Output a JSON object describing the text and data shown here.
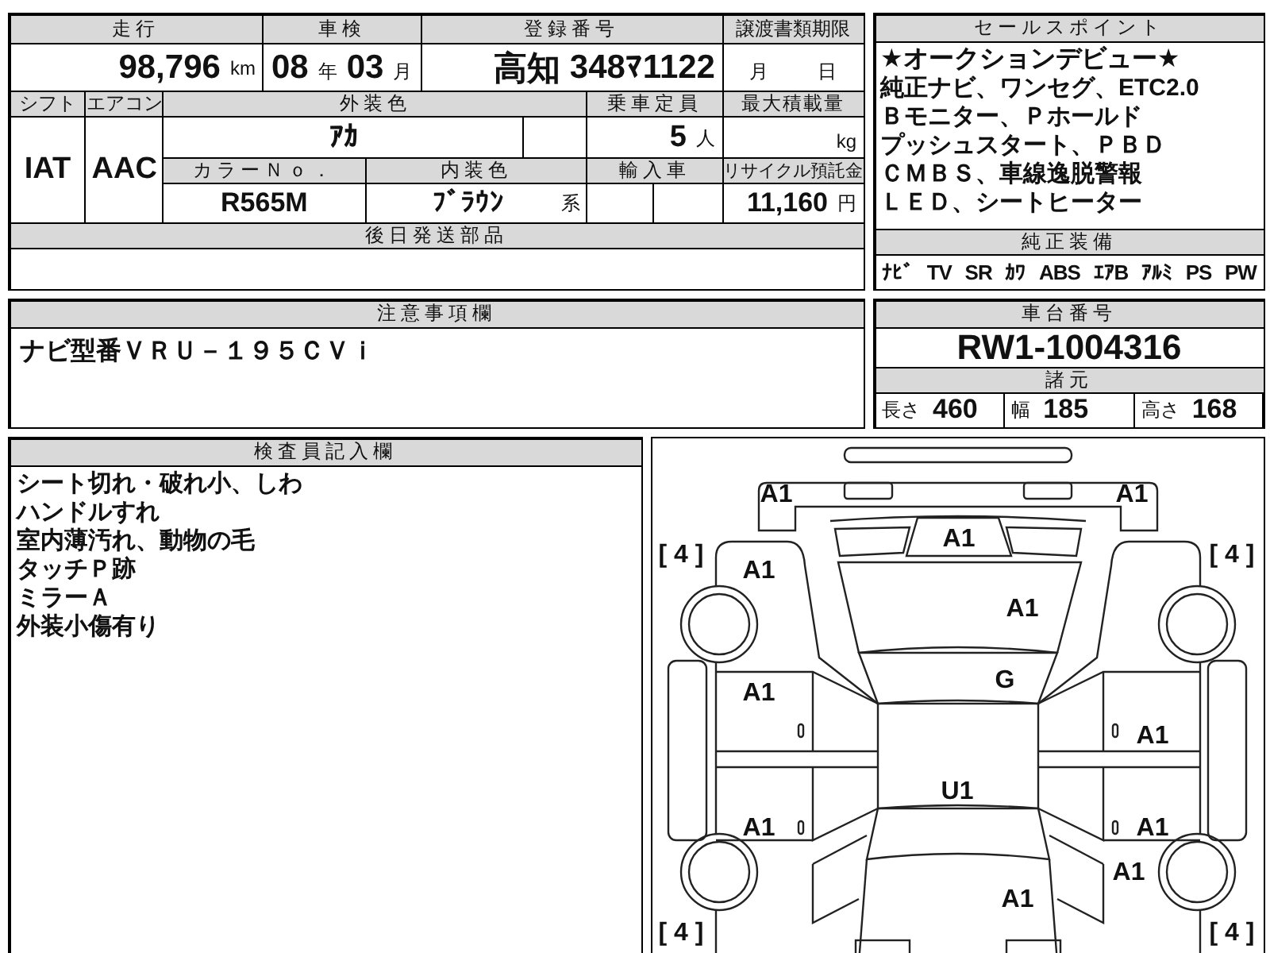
{
  "mileage": {
    "label": "走行",
    "value": "98,796",
    "unit": "km"
  },
  "inspection": {
    "label": "車検",
    "year": "08",
    "year_unit": "年",
    "month": "03",
    "month_unit": "月"
  },
  "registration": {
    "label": "登録番号",
    "region": "高知",
    "number": "348ﾏ1122"
  },
  "transfer_deadline": {
    "label": "譲渡書類期限",
    "month_unit": "月",
    "day_unit": "日"
  },
  "shift": {
    "label": "シフト",
    "value": "IAT"
  },
  "aircon": {
    "label": "エアコン",
    "value": "AAC"
  },
  "exterior_color": {
    "label": "外装色",
    "value": "ｱｶ"
  },
  "capacity": {
    "label": "乗車定員",
    "value": "5",
    "unit": "人"
  },
  "max_load": {
    "label": "最大積載量",
    "unit": "kg"
  },
  "color_no": {
    "label": "カラーＮｏ．",
    "value": "R565M"
  },
  "interior_color": {
    "label": "内装色",
    "value": "ﾌﾞﾗｳﾝ",
    "suffix": "系"
  },
  "imported": {
    "label": "輸入車"
  },
  "recycle_fee": {
    "label": "リサイクル預託金",
    "value": "11,160",
    "unit": "円"
  },
  "later_parts": {
    "label": "後日発送部品"
  },
  "notes": {
    "label": "注意事項欄",
    "text": "ナビ型番ＶＲＵ－１９５ＣＶｉ"
  },
  "sales_points": {
    "label": "セールスポイント",
    "lines": [
      "★オークションデビュー★",
      "純正ナビ、ワンセグ、ETC2.0",
      "Ｂモニター、Ｐホールド",
      "プッシュスタート、ＰＢＤ",
      "ＣＭＢＳ、車線逸脱警報",
      "ＬＥＤ、シートヒーター"
    ]
  },
  "standard_equipment": {
    "label": "純正装備",
    "items": [
      "ﾅﾋﾞ",
      "TV",
      "SR",
      "ｶﾜ",
      "ABS",
      "ｴｱB",
      "ｱﾙﾐ",
      "PS",
      "PW"
    ]
  },
  "chassis": {
    "label": "車台番号",
    "value": "RW1-1004316"
  },
  "specs": {
    "label": "諸元",
    "items": [
      {
        "label": "長さ",
        "value": "460"
      },
      {
        "label": "幅",
        "value": "185"
      },
      {
        "label": "高さ",
        "value": "168"
      }
    ]
  },
  "inspector_notes": {
    "label": "検査員記入欄",
    "lines": [
      "シート切れ・破れ小、しわ",
      "ハンドルすれ",
      "室内薄汚れ、動物の毛",
      "タッチＰ跡",
      "ミラーＡ",
      "外装小傷有り"
    ]
  },
  "damage_map": {
    "marks": [
      "A1",
      "A1",
      "A1",
      "A1",
      "A1",
      "G",
      "A1",
      "A1",
      "U1",
      "A1",
      "A1",
      "A1",
      "A1"
    ],
    "tire_depths": [
      "[ 4 ]",
      "[ 4 ]",
      "[ 4 ]",
      "[ 4 ]"
    ]
  }
}
